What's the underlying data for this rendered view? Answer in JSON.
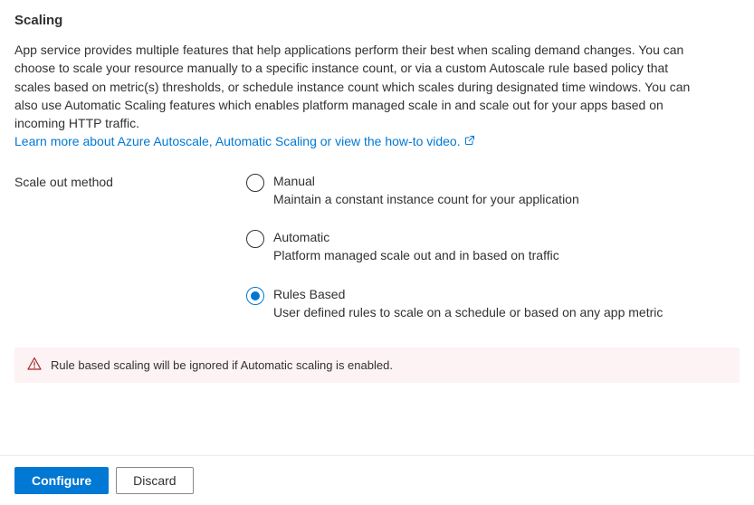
{
  "heading": "Scaling",
  "description": "App service provides multiple features that help applications perform their best when scaling demand changes. You can choose to scale your resource manually to a specific instance count, or via a custom Autoscale rule based policy that scales based on metric(s) thresholds, or schedule instance count which scales during designated time windows. You can also use Automatic Scaling features which enables platform managed scale in and scale out for your apps based on incoming HTTP traffic.",
  "learn_more_text": "Learn more about Azure Autoscale, Automatic Scaling or view the how-to video.",
  "form": {
    "scale_out_label": "Scale out method",
    "options": [
      {
        "title": "Manual",
        "subtitle": "Maintain a constant instance count for your application",
        "selected": false
      },
      {
        "title": "Automatic",
        "subtitle": "Platform managed scale out and in based on traffic",
        "selected": false
      },
      {
        "title": "Rules Based",
        "subtitle": "User defined rules to scale on a schedule or based on any app metric",
        "selected": true
      }
    ]
  },
  "warning": "Rule based scaling will be ignored if Automatic scaling is enabled.",
  "buttons": {
    "configure": "Configure",
    "discard": "Discard"
  }
}
